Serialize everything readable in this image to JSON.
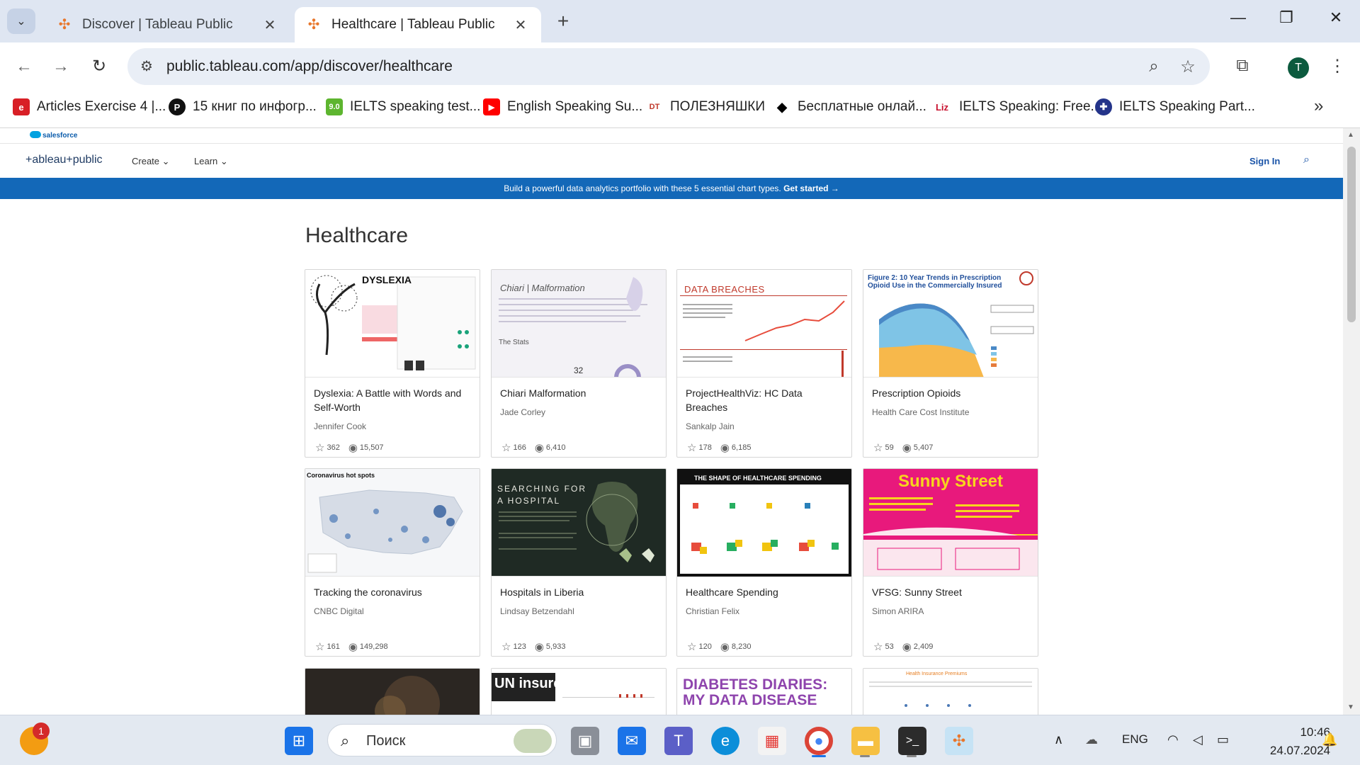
{
  "browser": {
    "tabs": [
      {
        "title": "Discover | Tableau Public"
      },
      {
        "title": "Healthcare | Tableau Public"
      }
    ],
    "url": "public.tableau.com/app/discover/healthcare",
    "profile_initial": "T",
    "bookmarks": [
      {
        "label": "Articles Exercise 4 |...",
        "icon": "e",
        "color": "#d81f26"
      },
      {
        "label": "15 книг по инфогр...",
        "icon": "P",
        "color": "#111111"
      },
      {
        "label": "IELTS speaking test...",
        "icon": "9.0",
        "color": "#5db52f"
      },
      {
        "label": "English Speaking Su...",
        "icon": "▶",
        "color": "#ff0000"
      },
      {
        "label": "ПОЛЕЗНЯШКИ",
        "icon": "DT",
        "color": "#ffffff"
      },
      {
        "label": "Бесплатные онлай...",
        "icon": "◆",
        "color": "#ffffff"
      },
      {
        "label": "IELTS Speaking: Free...",
        "icon": "Liz",
        "color": "#ffffff"
      },
      {
        "label": "IELTS Speaking Part...",
        "icon": "✚",
        "color": "#cc2233"
      }
    ]
  },
  "site": {
    "salesforce": "salesforce",
    "logo": "+ableau+public",
    "menu": [
      "Create",
      "Learn"
    ],
    "sign_in": "Sign In",
    "banner_text": "Build a powerful data analytics portfolio with these 5 essential chart types.",
    "banner_link": "Get started →"
  },
  "page": {
    "title": "Healthcare"
  },
  "cards": [
    {
      "title": "Dyslexia: A Battle with Words and Self-Worth",
      "author": "Jennifer Cook",
      "favorites": "362",
      "views": "15,507",
      "thumb_title": "DYSLEXIA"
    },
    {
      "title": "Chiari Malformation",
      "author": "Jade Corley",
      "favorites": "166",
      "views": "6,410",
      "thumb_title": "Chiari | Malformation"
    },
    {
      "title": "ProjectHealthViz: HC Data Breaches",
      "author": "Sankalp Jain",
      "favorites": "178",
      "views": "6,185",
      "thumb_title": "DATA BREACHES"
    },
    {
      "title": "Prescription Opioids",
      "author": "Health Care Cost Institute",
      "favorites": "59",
      "views": "5,407",
      "thumb_title": "Figure 2: 10 Year Trends in Prescription Opioid Use in the Commercially Insured"
    },
    {
      "title": "Tracking the coronavirus",
      "author": "CNBC Digital",
      "favorites": "161",
      "views": "149,298",
      "thumb_title": "Coronavirus hot spots"
    },
    {
      "title": "Hospitals in Liberia",
      "author": "Lindsay Betzendahl",
      "favorites": "123",
      "views": "5,933",
      "thumb_title": "SEARCHING FOR A HOSPITAL"
    },
    {
      "title": "Healthcare Spending",
      "author": "Christian Felix",
      "favorites": "120",
      "views": "8,230",
      "thumb_title": "THE SHAPE OF HEALTHCARE SPENDING"
    },
    {
      "title": "VFSG: Sunny Street",
      "author": "Simon ARIRA",
      "favorites": "53",
      "views": "2,409",
      "thumb_title": "Sunny Street"
    },
    {
      "thumb_title": ""
    },
    {
      "thumb_title": "UN insured"
    },
    {
      "thumb_title": "DIABETES DIARIES: MY DATA DISEASE"
    },
    {
      "thumb_title": "Health Insurance Premiums"
    }
  ],
  "taskbar": {
    "search_placeholder": "Поиск",
    "notification_count": "1",
    "language": "ENG",
    "time": "10:46",
    "date": "24.07.2024"
  }
}
